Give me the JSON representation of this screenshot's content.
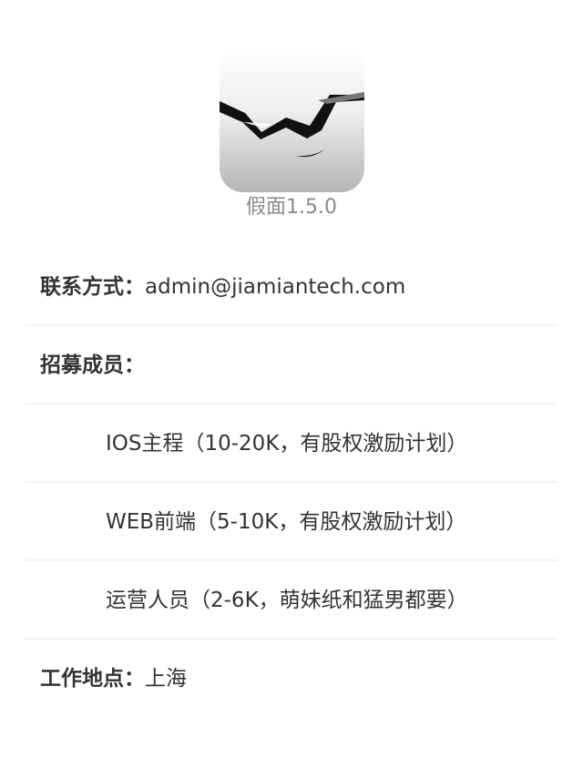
{
  "app": {
    "version_text": "假面1.5.0",
    "logo_icon": "mask-logo-icon"
  },
  "contact": {
    "label": "联系方式：",
    "value": "admin@jiamiantech.com"
  },
  "recruitment": {
    "label": "招募成员：",
    "positions": [
      "IOS主程（10-20K，有股权激励计划）",
      "WEB前端（5-10K，有股权激励计划）",
      "运营人员（2-6K，萌妹纸和猛男都要）"
    ]
  },
  "location": {
    "label": "工作地点：",
    "value": "上海"
  },
  "colors": {
    "background": "#ffffff",
    "text": "#333333",
    "version": "#8a8a8a",
    "divider": "#f2f2f2"
  }
}
